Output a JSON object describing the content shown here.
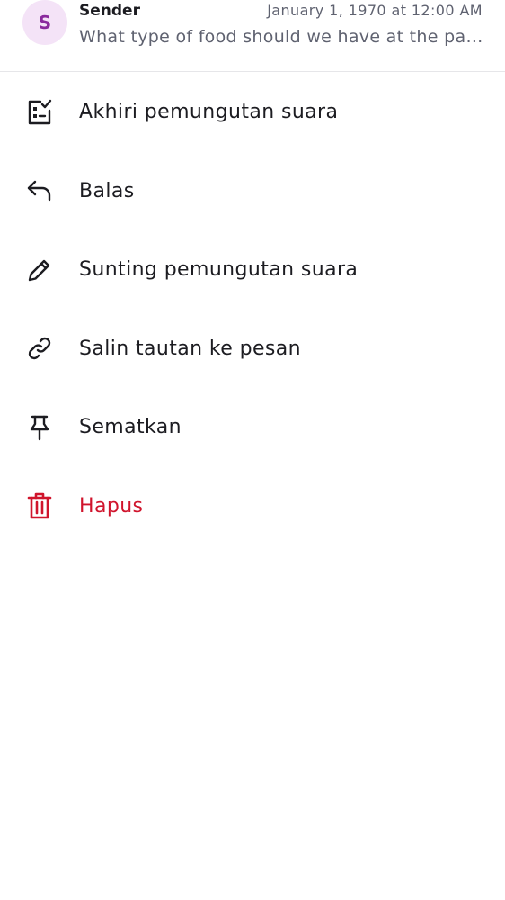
{
  "message": {
    "avatar_initial": "S",
    "sender": "Sender",
    "timestamp": "January 1, 1970 at 12:00 AM",
    "preview": "What type of food should we have at the party?"
  },
  "menu": {
    "items": [
      {
        "label": "Akhiri pemungutan suara",
        "icon": "end-poll-icon"
      },
      {
        "label": "Balas",
        "icon": "reply-icon"
      },
      {
        "label": "Sunting pemungutan suara",
        "icon": "pencil-icon"
      },
      {
        "label": "Salin tautan ke pesan",
        "icon": "link-icon"
      },
      {
        "label": "Sematkan",
        "icon": "pin-icon"
      },
      {
        "label": "Hapus",
        "icon": "trash-icon"
      }
    ]
  },
  "colors": {
    "text": "#1c1c21",
    "muted": "#5f6270",
    "danger": "#d0142c",
    "avatar_bg": "#f4e3f7",
    "avatar_fg": "#8a2a9d"
  }
}
